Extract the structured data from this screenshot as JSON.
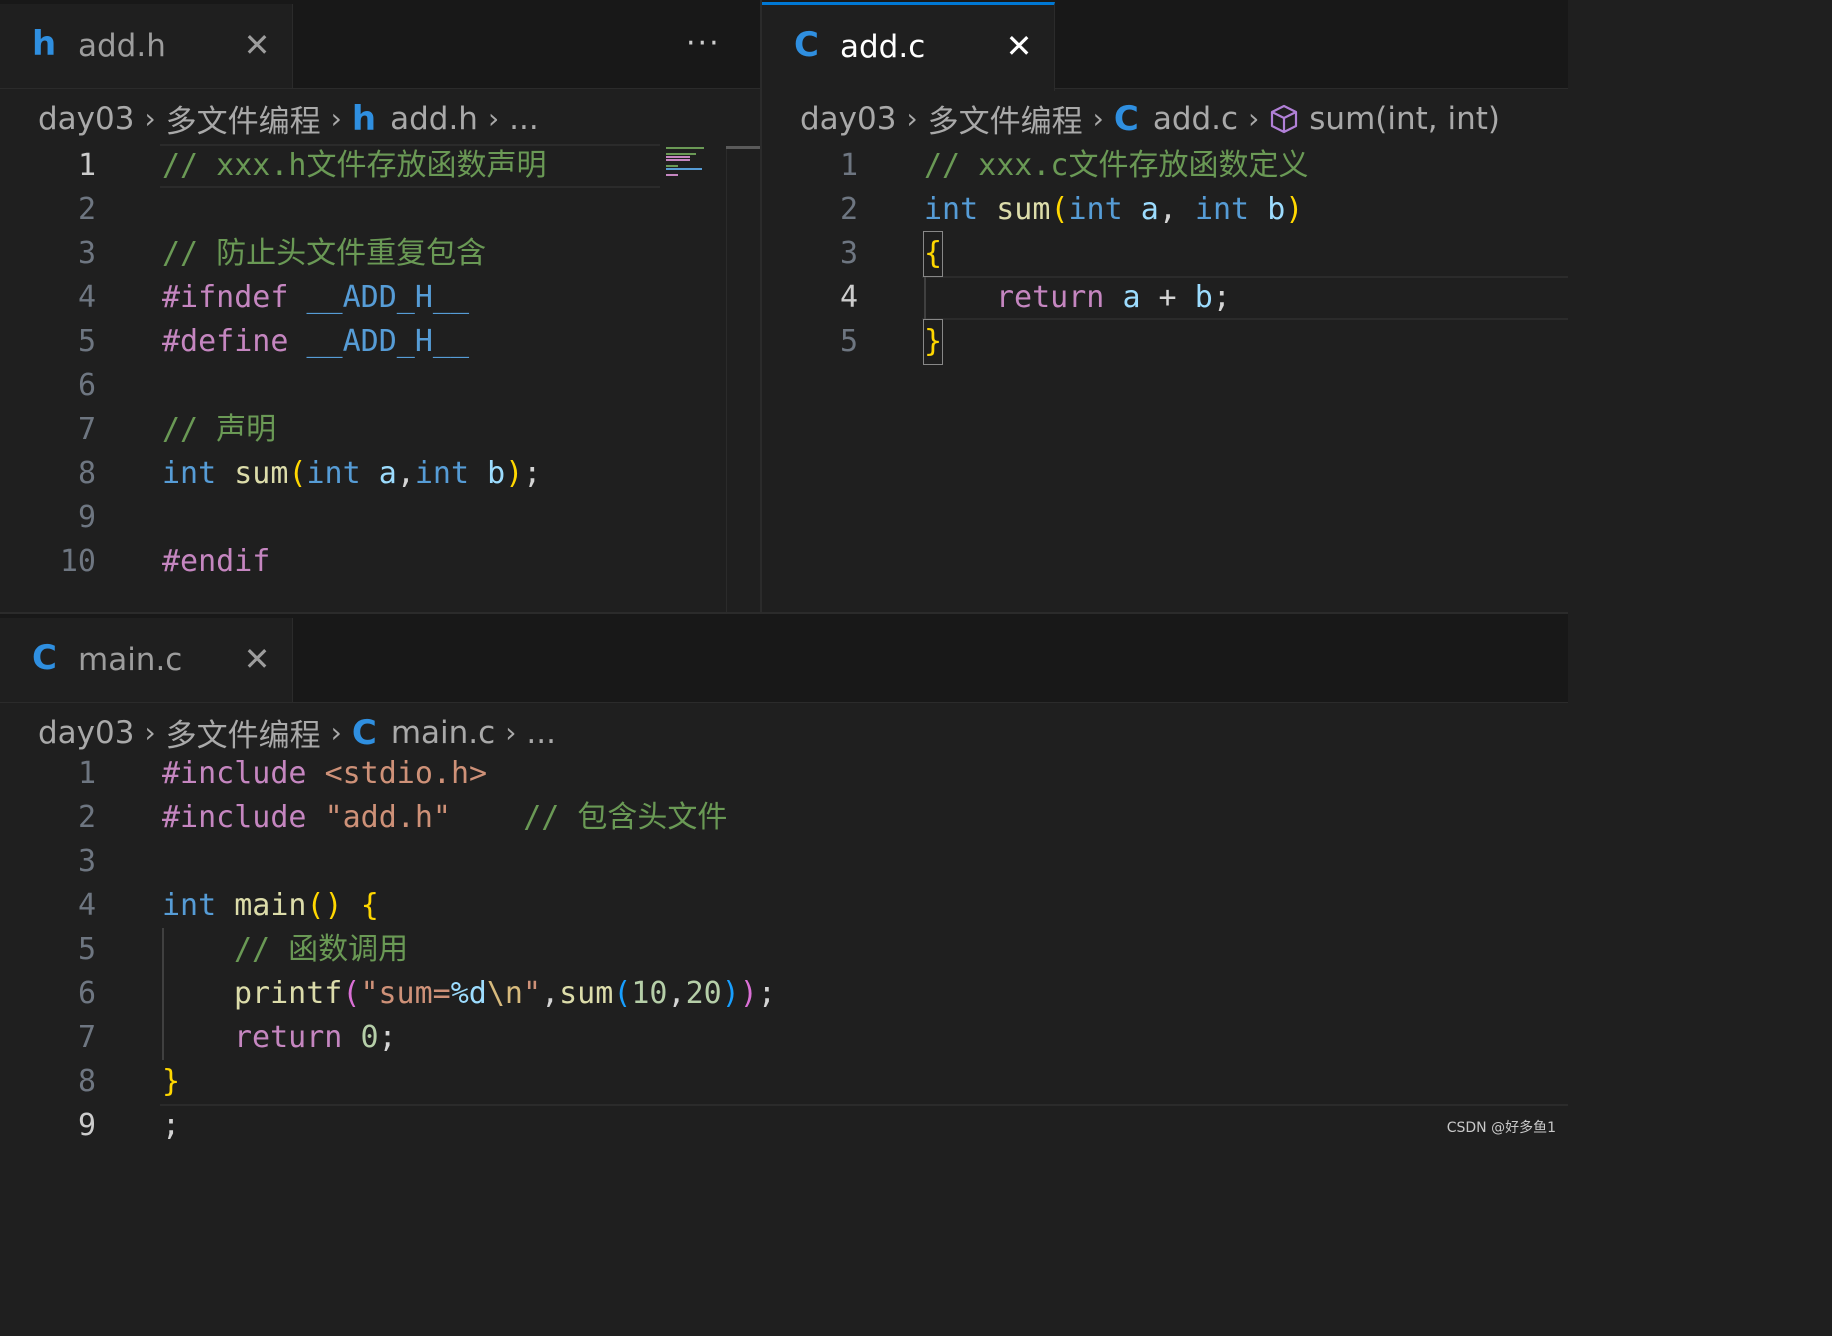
{
  "colors": {
    "accent": "#0078d4",
    "background": "#1f1f1f",
    "tabbar": "#181818"
  },
  "icons": {
    "h_file": "h",
    "c_file": "C",
    "close": "✕",
    "more": "···",
    "chevron": "›",
    "symbol": "cube-icon"
  },
  "top_left": {
    "tab": {
      "icon": "h",
      "label": "add.h",
      "close": "✕"
    },
    "more": "···",
    "breadcrumb": [
      "day03",
      "多文件编程",
      "add.h",
      "..."
    ],
    "lines": [
      "1",
      "2",
      "3",
      "4",
      "5",
      "6",
      "7",
      "8",
      "9",
      "10"
    ],
    "code": {
      "l1": "// xxx.h文件存放函数声明",
      "l3": "// 防止头文件重复包含",
      "l4a": "#ifndef",
      "l4b": "__ADD_H__",
      "l5a": "#define",
      "l5b": "__ADD_H__",
      "l7": "// 声明",
      "l8": {
        "int1": "int",
        "fn": "sum",
        "po": "(",
        "int2": "int",
        "a": "a",
        "comma": ",",
        "int3": "int",
        "b": "b",
        "pc": ")",
        "semi": ";"
      },
      "l10": "#endif"
    }
  },
  "top_right": {
    "tab": {
      "icon": "C",
      "label": "add.c",
      "close": "✕"
    },
    "breadcrumb": [
      "day03",
      "多文件编程",
      "add.c",
      "sum(int, int)"
    ],
    "lines": [
      "1",
      "2",
      "3",
      "4",
      "5"
    ],
    "code": {
      "l1": "// xxx.c文件存放函数定义",
      "l2": {
        "int1": "int",
        "fn": "sum",
        "po": "(",
        "int2": "int",
        "a": "a",
        "comma": ", ",
        "int3": "int",
        "b": "b",
        "pc": ")"
      },
      "l3": "{",
      "l4": {
        "ret": "return",
        "a": "a",
        "op": " + ",
        "b": "b",
        "semi": ";"
      },
      "l5": "}"
    }
  },
  "bottom": {
    "tab": {
      "icon": "C",
      "label": "main.c",
      "close": "✕"
    },
    "breadcrumb": [
      "day03",
      "多文件编程",
      "main.c",
      "..."
    ],
    "lines": [
      "1",
      "2",
      "3",
      "4",
      "5",
      "6",
      "7",
      "8",
      "9"
    ],
    "code": {
      "l1a": "#include",
      "l1b": "<stdio.h>",
      "l2a": "#include",
      "l2b": "\"add.h\"",
      "l2c": "// 包含头文件",
      "l4": {
        "int": "int",
        "fn": "main",
        "paren": "()",
        "brace": "{"
      },
      "l5": "// 函数调用",
      "l6": {
        "fn": "printf",
        "po": "(",
        "s1": "\"sum=",
        "fmt": "%d",
        "esc": "\\n",
        "s2": "\"",
        "comma1": ",",
        "fn2": "sum",
        "po2": "(",
        "n1": "10",
        "comma2": ",",
        "n2": "20",
        "pc2": ")",
        "pc": ")",
        "semi": ";"
      },
      "l7": {
        "ret": "return",
        "n": "0",
        "semi": ";"
      },
      "l8": "}",
      "l9": ";"
    }
  },
  "watermark": "CSDN @好多鱼1"
}
